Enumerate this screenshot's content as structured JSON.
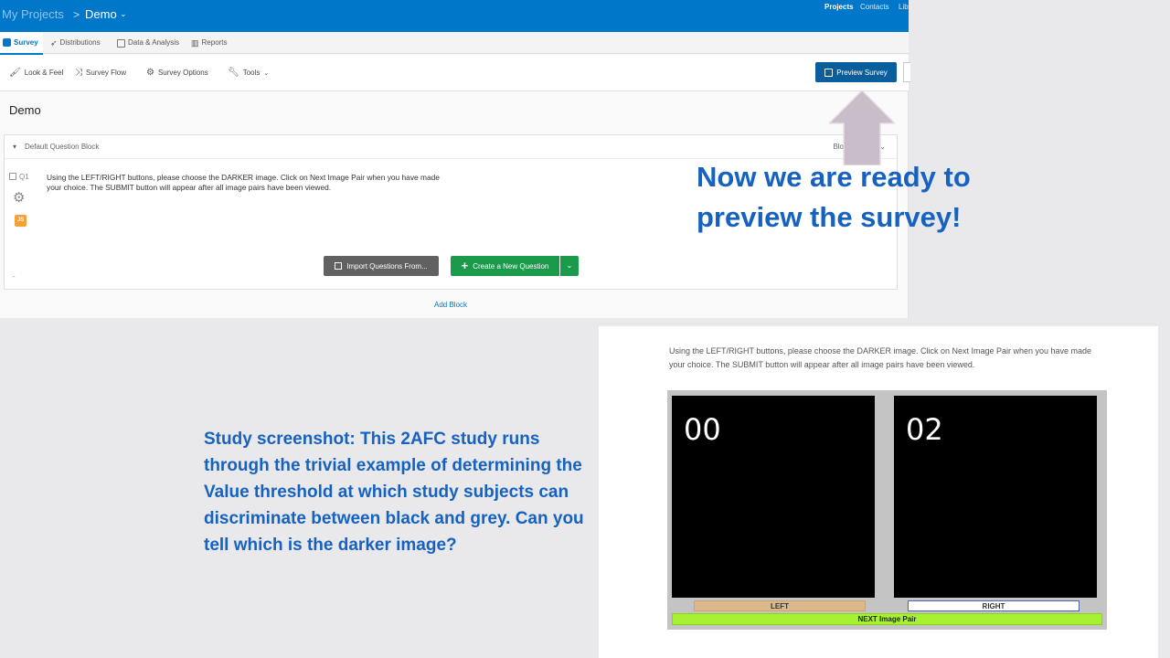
{
  "header": {
    "breadcrumb_root": "My Projects",
    "breadcrumb_sep": ">",
    "project_name": "Demo",
    "nav": [
      "Projects",
      "Contacts",
      "Lib"
    ]
  },
  "tabs": [
    {
      "label": "Survey",
      "icon": "survey-icon"
    },
    {
      "label": "Distributions",
      "icon": "send-icon"
    },
    {
      "label": "Data & Analysis",
      "icon": "table-icon"
    },
    {
      "label": "Reports",
      "icon": "bar-chart-icon"
    }
  ],
  "toolbar": {
    "look_feel": "Look & Feel",
    "survey_flow": "Survey Flow",
    "survey_options": "Survey Options",
    "tools": "Tools",
    "preview": "Preview Survey"
  },
  "editor": {
    "survey_title": "Demo",
    "block_name": "Default Question Block",
    "block_options": "Block",
    "question_number": "Q1",
    "js_badge": "JS",
    "question_text": "Using the LEFT/RIGHT buttons, please choose the DARKER image. Click on Next Image Pair when you have made your choice. The SUBMIT button will appear after all image pairs have been viewed.",
    "import_button": "Import Questions From...",
    "create_button": "Create a New Question",
    "add_block": "Add Block"
  },
  "annotations": {
    "top": "Now we are ready to preview the survey!",
    "bottom": "Study screenshot: This 2AFC study runs through the trivial example of determining the Value threshold at which study subjects can discriminate between black and grey. Can you tell which is the darker image?"
  },
  "study": {
    "instructions": "Using the LEFT/RIGHT buttons, please choose the DARKER image. Click on Next Image Pair when you have made your choice. The SUBMIT button will appear after all image pairs have been viewed.",
    "left_label": "00",
    "right_label": "02",
    "left_button": "LEFT",
    "right_button": "RIGHT",
    "next_button": "NEXT Image Pair"
  },
  "colors": {
    "brand_blue": "#0077c8",
    "callout_blue": "#1662c1",
    "create_green": "#1b9a4b",
    "next_green": "#a5f233",
    "left_tan": "#ddb88a",
    "arrow_mauve": "#c9bdca"
  }
}
